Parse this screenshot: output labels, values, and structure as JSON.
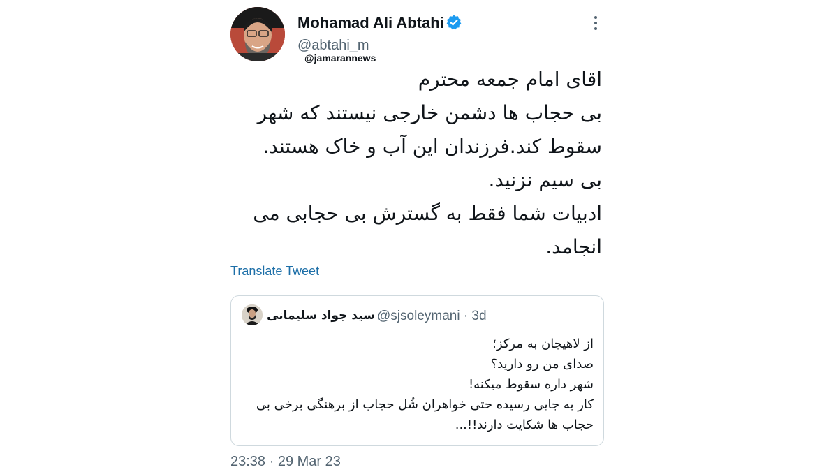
{
  "author": {
    "name": "Mohamad Ali Abtahi",
    "handle": "@abtahi_m",
    "verified": true,
    "avatar_icon": "profile-photo"
  },
  "watermark": "@jamarannews",
  "tweet": {
    "lines": [
      "اقای امام جمعه محترم",
      "بی حجاب ها دشمن خارجی نیستند که شهر",
      "سقوط کند.فرزندان این آب و خاک هستند.",
      "بی سیم نزنید.",
      "ادبیات شما فقط به گسترش بی حجابی  می",
      "انجامد."
    ],
    "translate_label": "Translate Tweet",
    "timestamp": "23:38 · 29 Mar 23"
  },
  "quoted": {
    "name": "سید جواد سلیمانی",
    "handle_time": "@sjsoleymani · 3d",
    "lines": [
      "از لاهیجان به مرکز؛",
      "صدای من رو دارید؟",
      "شهر داره سقوط میکنه!",
      "کار به جایی رسیده حتی خواهران شُل حجاب از برهنگی برخی بی",
      "حجاب ها شکایت دارند!!..."
    ]
  },
  "colors": {
    "verified_blue": "#1d9bf0",
    "link_blue": "#1d6fa8",
    "secondary_text": "#536471",
    "border": "#cfd9de"
  }
}
